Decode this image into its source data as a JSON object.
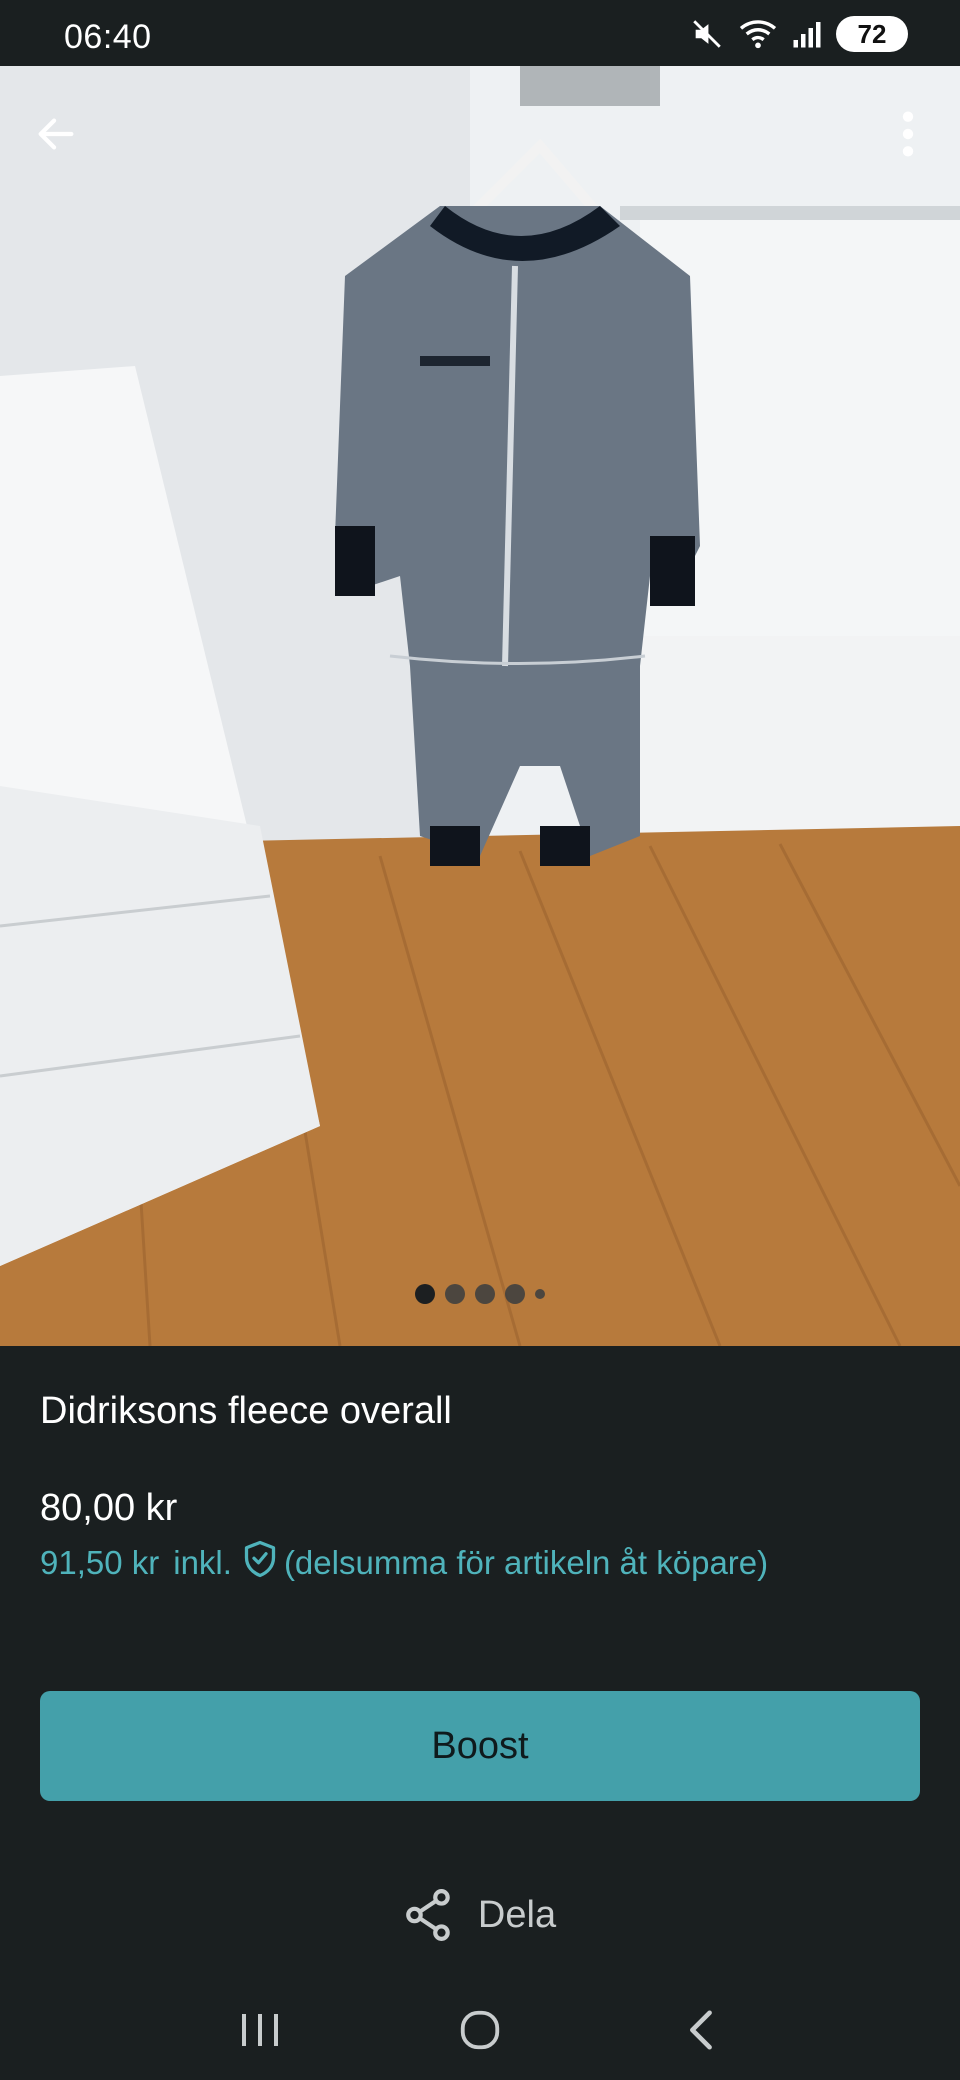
{
  "status_bar": {
    "time": "06:40",
    "battery": "72",
    "icons": [
      "mute-icon",
      "wifi-icon",
      "signal-icon",
      "battery-icon"
    ]
  },
  "photo": {
    "page_count": 5,
    "current_page": 1,
    "back_icon": "arrow-left-icon",
    "menu_icon": "more-vertical-icon"
  },
  "listing": {
    "title": "Didriksons fleece overall",
    "price": "80,00 kr",
    "price_incl_amount": "91,50 kr",
    "price_incl_word": "inkl.",
    "price_incl_note": "(delsumma för artikeln åt köpare)",
    "shield_icon": "shield-check-icon"
  },
  "actions": {
    "boost_label": "Boost",
    "share_label": "Dela",
    "share_icon": "share-icon"
  },
  "nav": {
    "recents_icon": "recents-icon",
    "home_icon": "home-icon",
    "back_icon": "back-chevron-icon"
  },
  "colors": {
    "background": "#1a1f20",
    "accent": "#44a0aa",
    "accent_text": "#4fb3bb"
  }
}
